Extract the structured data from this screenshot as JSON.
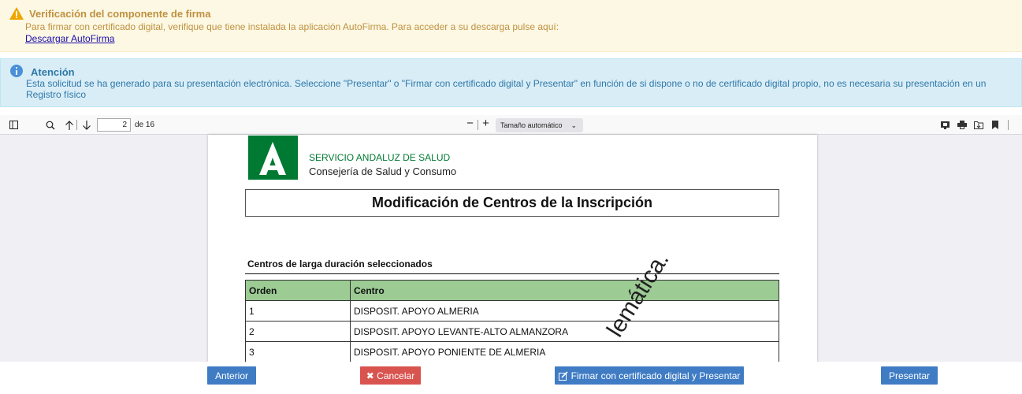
{
  "warning": {
    "title": "Verificación del componente de firma",
    "text": "Para firmar con certificado digital, verifique que tiene instalada la aplicación AutoFirma. Para acceder a su descarga pulse aquí:",
    "link": "Descargar AutoFirma"
  },
  "info": {
    "title": "Atención",
    "text": "Esta solicitud se ha generado para su presentación electrónica. Seleccione \"Presentar\" o \"Firmar con certificado digital y Presentar\" en función de si dispone o no de certificado digital propio, no es necesaria su presentación en un Registro físico"
  },
  "viewer": {
    "current_page": "2",
    "page_of": "de 16",
    "zoom_minus": "−",
    "zoom_plus": "+",
    "zoom_label": "Tamaño automático",
    "zoom_caret": "⌄"
  },
  "document": {
    "org_line1": "SERVICIO ANDALUZ DE SALUD",
    "org_line2": "Consejería de Salud y Consumo",
    "title": "Modificación de Centros de la Inscripción",
    "section_title": "Centros de larga duración seleccionados",
    "table_headers": [
      "Orden",
      "Centro"
    ],
    "table_rows": [
      [
        "1",
        "DISPOSIT. APOYO ALMERIA"
      ],
      [
        "2",
        "DISPOSIT. APOYO LEVANTE-ALTO ALMANZORA"
      ],
      [
        "3",
        "DISPOSIT. APOYO PONIENTE DE ALMERIA"
      ]
    ],
    "watermark": "lemática."
  },
  "buttons": {
    "anterior": "Anterior",
    "cancelar": "✖ Cancelar",
    "firmar": "Firmar con certificado digital y Presentar",
    "presentar": "Presentar"
  },
  "colors": {
    "warning_bg": "#fcf8e3",
    "info_bg": "#d9edf7",
    "primary_button": "#3f7cc4",
    "danger_button": "#d9534f",
    "brand_green": "#007a33",
    "table_header_green": "#9ccb94"
  }
}
